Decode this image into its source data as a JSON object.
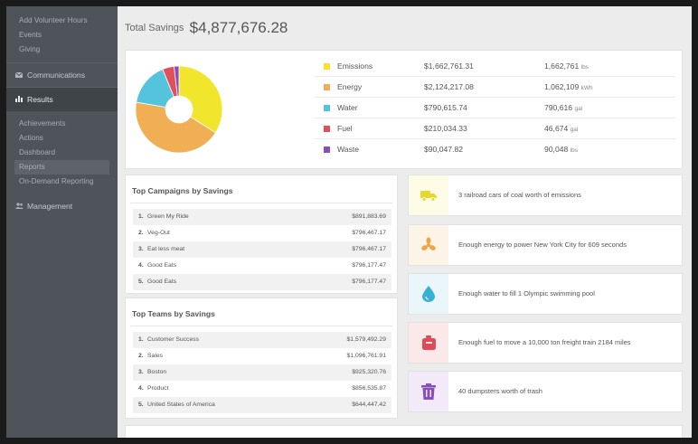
{
  "sidebar": {
    "top_items": [
      {
        "label": "Add Volunteer Hours"
      },
      {
        "label": "Events"
      },
      {
        "label": "Giving"
      }
    ],
    "communications": {
      "label": "Communications",
      "icon": "envelope-icon"
    },
    "results": {
      "label": "Results",
      "icon": "bar-chart-icon"
    },
    "results_items": [
      {
        "label": "Achievements"
      },
      {
        "label": "Actions"
      },
      {
        "label": "Dashboard"
      },
      {
        "label": "Reports"
      },
      {
        "label": "On-Demand Reporting"
      }
    ],
    "management": {
      "label": "Management",
      "icon": "users-icon"
    }
  },
  "total": {
    "label": "Total Savings",
    "value": "$4,877,676.28"
  },
  "chart_data": {
    "type": "pie",
    "categories": [
      "Emissions",
      "Energy",
      "Water",
      "Fuel",
      "Waste"
    ],
    "values": [
      1662761.31,
      2124217.08,
      790615.74,
      210034.33,
      90047.82
    ],
    "colors": [
      "#f2e62c",
      "#f0ae55",
      "#55c3dc",
      "#e0505a",
      "#8a4fb6"
    ]
  },
  "legend": [
    {
      "name": "Emissions",
      "money": "$1,662,761.31",
      "amount": "1,662,761",
      "unit": "lbs",
      "color": "#f2e62c"
    },
    {
      "name": "Energy",
      "money": "$2,124,217.08",
      "amount": "1,062,109",
      "unit": "kWh",
      "color": "#f0ae55"
    },
    {
      "name": "Water",
      "money": "$790,615.74",
      "amount": "790,616",
      "unit": "gal",
      "color": "#55c3dc"
    },
    {
      "name": "Fuel",
      "money": "$210,034.33",
      "amount": "46,674",
      "unit": "gal",
      "color": "#e0505a"
    },
    {
      "name": "Waste",
      "money": "$90,047.82",
      "amount": "90,048",
      "unit": "lbs",
      "color": "#8a4fb6"
    }
  ],
  "campaigns": {
    "title": "Top Campaigns by Savings",
    "rows": [
      {
        "rank": "1.",
        "name": "Green My Ride",
        "value": "$891,883.69"
      },
      {
        "rank": "2.",
        "name": "Veg-Out",
        "value": "$796,467.17"
      },
      {
        "rank": "3.",
        "name": "Eat less meat",
        "value": "$796,467.17"
      },
      {
        "rank": "4.",
        "name": "Good Eats",
        "value": "$796,177.47"
      },
      {
        "rank": "5.",
        "name": "Good Eats",
        "value": "$796,177.47"
      }
    ]
  },
  "teams": {
    "title": "Top Teams by Savings",
    "rows": [
      {
        "rank": "1.",
        "name": "Customer Success",
        "value": "$1,579,492.29"
      },
      {
        "rank": "2.",
        "name": "Sales",
        "value": "$1,096,761.91"
      },
      {
        "rank": "3.",
        "name": "Boston",
        "value": "$925,320.76"
      },
      {
        "rank": "4.",
        "name": "Product",
        "value": "$856,535.87"
      },
      {
        "rank": "5.",
        "name": "United States of America",
        "value": "$644,447.42"
      }
    ]
  },
  "facts": [
    {
      "text": "3 railroad cars of coal worth of emissions",
      "icon": "truck-icon",
      "bg": "#fdfce6",
      "color": "#e7d829"
    },
    {
      "text": "Enough energy to power New York City for 609 seconds",
      "icon": "fan-icon",
      "bg": "#fdf4e8",
      "color": "#efa34a"
    },
    {
      "text": "Enough water to fill 1 Olympic swimming pool",
      "icon": "water-drop-icon",
      "bg": "#eaf6fa",
      "color": "#3ab0d2"
    },
    {
      "text": "Enough fuel to move a 10,000 ton freight train 2184 miles",
      "icon": "fuel-can-icon",
      "bg": "#fbe9ea",
      "color": "#de4a55"
    },
    {
      "text": "40 dumpsters worth of trash",
      "icon": "trash-icon",
      "bg": "#f2eaf8",
      "color": "#8a4fb6"
    }
  ]
}
